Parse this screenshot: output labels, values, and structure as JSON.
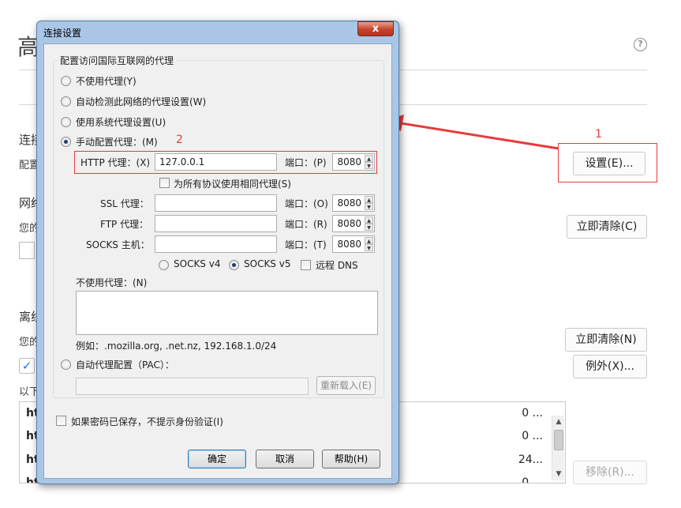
{
  "background": {
    "title": "高",
    "connection_heading": "连接",
    "connection_desc": "配置",
    "network_heading": "网络",
    "network_desc": "您的",
    "offline_heading": "离线",
    "offline_desc": "您的",
    "list_caption": "以下",
    "settings_button": "设置(E)...",
    "clear_now_button_1": "立即清除(C)",
    "clear_now_button_2": "立即清除(N)",
    "exceptions_button": "例外(X)...",
    "remove_button": "移除(R)...",
    "annotation_1": "1",
    "list_rows": [
      {
        "site": "htt",
        "size": "0 ..."
      },
      {
        "site": "htt",
        "size": "0 ..."
      },
      {
        "site": "htt",
        "size": "24..."
      },
      {
        "site": "htt",
        "size": "0 ..."
      }
    ]
  },
  "dialog": {
    "title": "连接设置",
    "close_label": "x",
    "group_title": "配置访问国际互联网的代理",
    "options": {
      "no_proxy": "不使用代理(Y)",
      "auto_detect": "自动检测此网络的代理设置(W)",
      "system_proxy": "使用系统代理设置(U)",
      "manual_proxy": "手动配置代理：(M)"
    },
    "annotation_2": "2",
    "http": {
      "label": "HTTP 代理：(X)",
      "value": "127.0.0.1",
      "port_label": "端口：(P)",
      "port": "8080"
    },
    "same_for_all": "为所有协议使用相同代理(S)",
    "ssl": {
      "label": "SSL 代理：",
      "value": "",
      "port_label": "端口：(O)",
      "port": "8080"
    },
    "ftp": {
      "label": "FTP 代理：",
      "value": "",
      "port_label": "端口：(R)",
      "port": "8080"
    },
    "socks": {
      "label": "SOCKS 主机：",
      "value": "",
      "port_label": "端口：(T)",
      "port": "8080"
    },
    "socks_v4": "SOCKS v4",
    "socks_v5": "SOCKS v5",
    "remote_dns": "远程 DNS",
    "no_proxy_for_label": "不使用代理：(N)",
    "no_proxy_for_value": "",
    "example": "例如：.mozilla.org, .net.nz, 192.168.1.0/24",
    "pac_label": "自动代理配置（PAC）：",
    "pac_url": "",
    "reload_button": "重新载入(E)",
    "no_auth_prompt": "如果密码已保存，不提示身份验证(I)",
    "ok_button": "确定",
    "cancel_button": "取消",
    "help_button": "帮助(H)"
  },
  "colors": {
    "annotation_red": "#e53c3c",
    "dialog_frame": "#aac6e6",
    "dialog_client": "#f0f0f0"
  }
}
